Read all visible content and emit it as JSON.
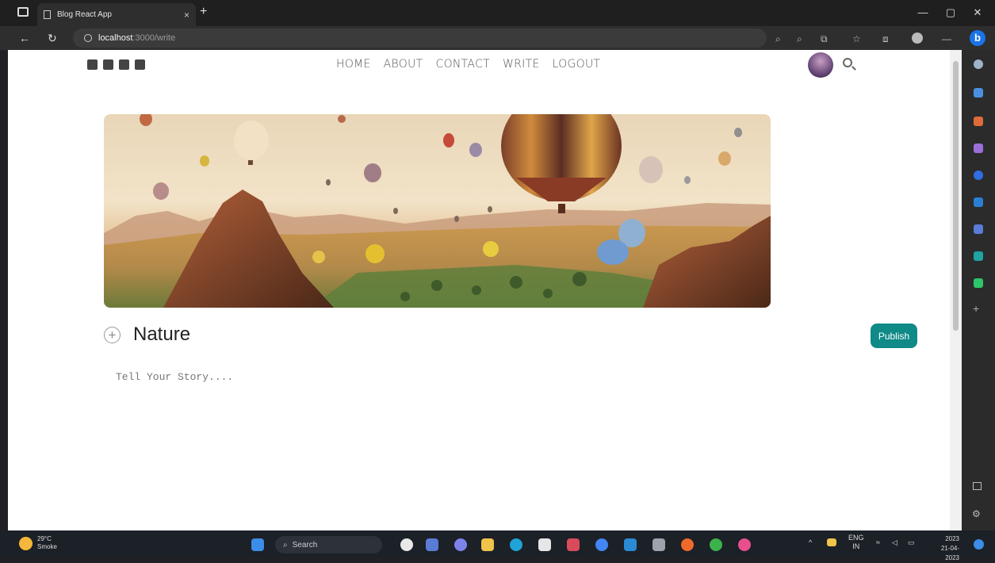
{
  "browser": {
    "tab_title": "Blog React App",
    "close_label": "×",
    "newtab_label": "+",
    "url_host": "localhost",
    "url_path": ":3000/write",
    "win_minimize": "—",
    "win_restore": "▢",
    "win_close": "✕",
    "back": "←",
    "reload": "↻"
  },
  "site": {
    "nav": [
      "HOME",
      "ABOUT",
      "CONTACT",
      "WRITE",
      "LOGOUT"
    ],
    "social_icons": [
      "facebook-square-icon",
      "twitter-square-icon",
      "pinterest-square-icon",
      "instagram-square-icon"
    ]
  },
  "write": {
    "title_value": "Nature",
    "add_symbol": "+",
    "publish_label": "Publish",
    "story_placeholder": "Tell Your Story...."
  },
  "taskbar": {
    "temperature": "29°C",
    "weather_text": "Smoke",
    "search_label": "Search",
    "lang_1": "ENG",
    "lang_2": "IN",
    "time": "2023",
    "date": "21-04-2023"
  },
  "colors": {
    "accent": "#0f8a87",
    "chrome_dark": "#1f1f1f",
    "taskbar": "#1c2027"
  }
}
